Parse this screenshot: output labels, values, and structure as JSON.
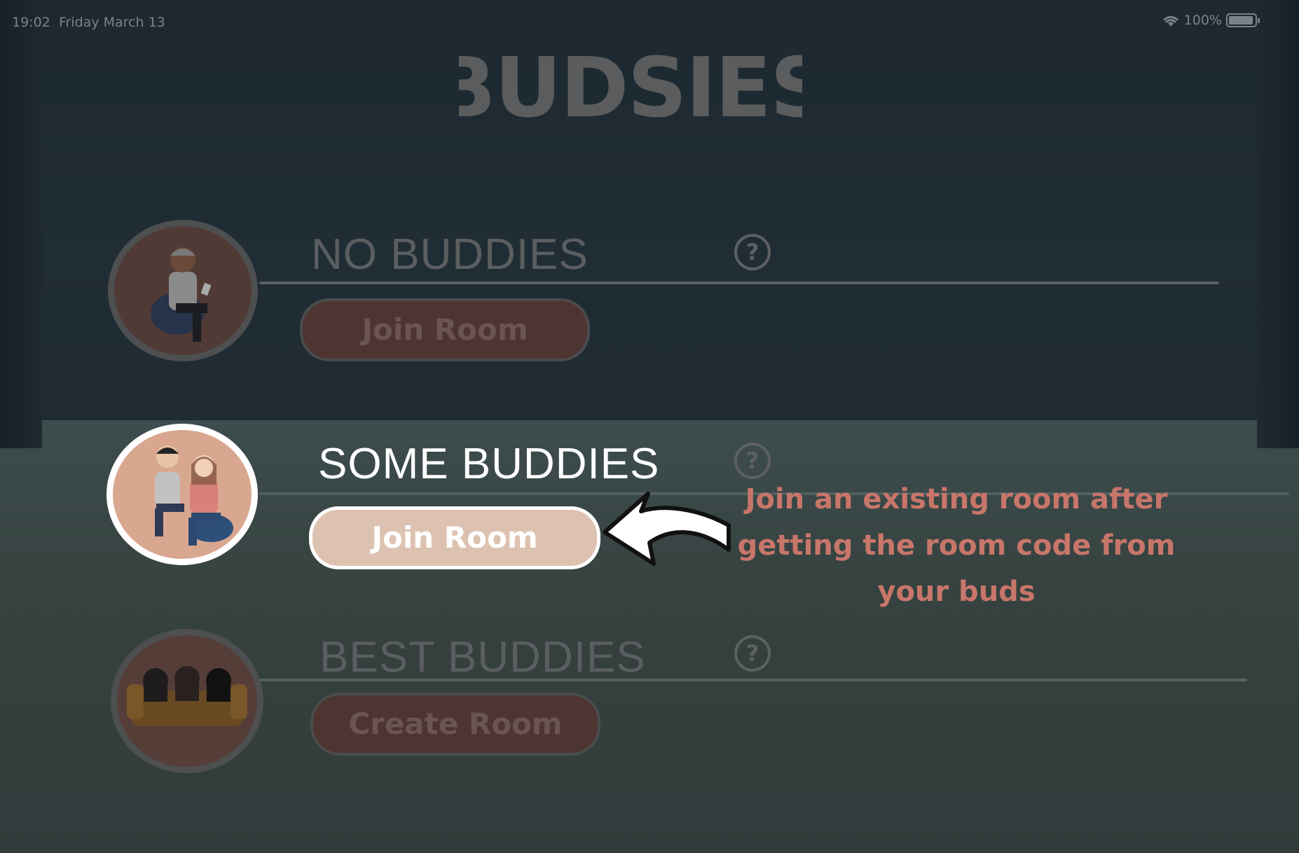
{
  "status_bar": {
    "time": "19:02",
    "date": "Friday March 13",
    "battery": "100%"
  },
  "app": {
    "logo": "BUDSIES"
  },
  "sections": [
    {
      "title": "NO BUDDIES",
      "button": "Join Room",
      "help": "?",
      "avatar": "single-buddy-on-beanbag",
      "state": "dimmed"
    },
    {
      "title": "SOME BUDDIES",
      "button": "Join Room",
      "help": "?",
      "avatar": "two-buddies-on-beanbags",
      "state": "highlighted"
    },
    {
      "title": "BEST BUDDIES",
      "button": "Create Room",
      "help": "?",
      "avatar": "three-buddies-on-couch",
      "state": "dimmed"
    }
  ],
  "tooltip": {
    "text_line1": "Join an existing room after",
    "text_line2": "getting the room code from",
    "text_line3": "your buds"
  },
  "colors": {
    "background": "#1f2a31",
    "accent_peach": "#dec2b1",
    "tooltip_text": "#c8766a",
    "dim_button": "#4e3531"
  }
}
